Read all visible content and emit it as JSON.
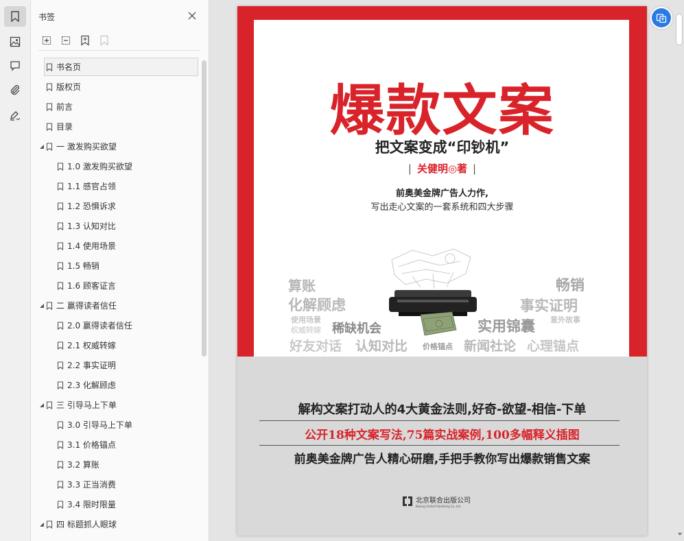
{
  "rail": {
    "buttons": [
      {
        "icon": "bookmark-icon",
        "active": true
      },
      {
        "icon": "image-icon",
        "active": false
      },
      {
        "icon": "comment-icon",
        "active": false
      },
      {
        "icon": "attachment-icon",
        "active": false
      },
      {
        "icon": "signature-icon",
        "active": false
      }
    ]
  },
  "panel": {
    "title": "书签",
    "tools": [
      "expand-all-icon",
      "collapse-all-icon",
      "add-bookmark-icon",
      "remove-bookmark-icon"
    ],
    "items": [
      {
        "label": "书名页",
        "level": 0,
        "expandable": false,
        "selected": true
      },
      {
        "label": "版权页",
        "level": 0,
        "expandable": false
      },
      {
        "label": "前言",
        "level": 0,
        "expandable": false
      },
      {
        "label": "目录",
        "level": 0,
        "expandable": false
      },
      {
        "label": "一 激发购买欲望",
        "level": 0,
        "expandable": true
      },
      {
        "label": "1.0 激发购买欲望",
        "level": 1
      },
      {
        "label": "1.1 感官占领",
        "level": 1
      },
      {
        "label": "1.2 恐惧诉求",
        "level": 1
      },
      {
        "label": "1.3 认知对比",
        "level": 1
      },
      {
        "label": "1.4 使用场景",
        "level": 1
      },
      {
        "label": "1.5 畅销",
        "level": 1
      },
      {
        "label": "1.6 顾客证言",
        "level": 1
      },
      {
        "label": "二 赢得读者信任",
        "level": 0,
        "expandable": true
      },
      {
        "label": "2.0 赢得读者信任",
        "level": 1
      },
      {
        "label": "2.1 权威转嫁",
        "level": 1
      },
      {
        "label": "2.2 事实证明",
        "level": 1
      },
      {
        "label": "2.3 化解顾虑",
        "level": 1
      },
      {
        "label": "三 引导马上下单",
        "level": 0,
        "expandable": true
      },
      {
        "label": "3.0 引导马上下单",
        "level": 1
      },
      {
        "label": "3.1 价格锚点",
        "level": 1
      },
      {
        "label": "3.2 算账",
        "level": 1
      },
      {
        "label": "3.3 正当消费",
        "level": 1
      },
      {
        "label": "3.4 限时限量",
        "level": 1
      },
      {
        "label": "四 标题抓人眼球",
        "level": 0,
        "expandable": true
      }
    ]
  },
  "cover": {
    "title": "爆款文案",
    "subtitle": "把文案变成“印钞机”",
    "author": "关健明◎著",
    "tagline1": "前奥美金牌广告人力作,",
    "tagline2": "写出走心文案的一套系统和四大步骤",
    "words": {
      "w1": "算账",
      "w2": "化解顾虑",
      "w3": "畅销",
      "w4": "事实证明",
      "w5": "使用场景",
      "w6": "权威转嫁",
      "w7": "稀缺机会",
      "w8": "实用锦囊",
      "w9": "意外故事",
      "w10": "好友对话",
      "w11": "认知对比",
      "w12": "价格锚点",
      "w13": "新闻社论",
      "w14": "心理锚点"
    },
    "line1": "解构文案打动人的4大黄金法则,好奇-欲望-相信-下单",
    "line2": "公开18种文案写法,75篇实战案例,100多幅释义插图",
    "line3": "前奥美金牌广告人精心研磨,手把手教你写出爆款销售文案",
    "publisher": "北京联合出版公司",
    "publisher_en": "Beijing United Publishing Co.,Ltd."
  },
  "colors": {
    "brand_red": "#d9232a",
    "accent_blue": "#2b7ae4"
  }
}
